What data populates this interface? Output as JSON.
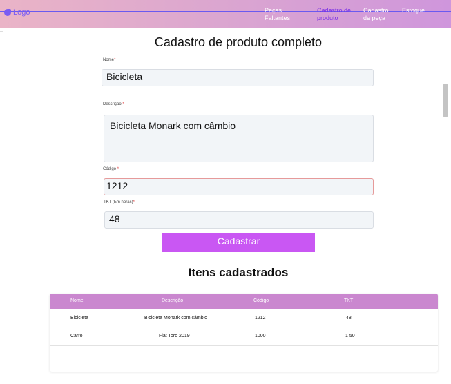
{
  "navbar": {
    "logo": "Logo",
    "links": [
      "Peças Faltantes",
      "Cadastro de produto",
      "Cadastro de peça",
      "Estoque"
    ]
  },
  "form": {
    "title": "Cadastro de produto completo",
    "nome": {
      "label": "Nome",
      "value": "Bicicleta"
    },
    "descricao": {
      "label": "Descrição",
      "value": "Bicicleta Monark com câmbio"
    },
    "codigo": {
      "label": "Código",
      "value": "1212"
    },
    "tkt": {
      "label": "TKT (Em horas)",
      "value": "48"
    },
    "required_mark": "*",
    "submit": "Cadastrar"
  },
  "table": {
    "title": "Itens cadastrados",
    "headers": [
      "Nome",
      "Descrição",
      "Código",
      "TKT"
    ],
    "rows": [
      [
        "Bicicleta",
        "Bicicleta Monark com câmbio",
        "1212",
        "48"
      ],
      [
        "Carro",
        "Fiat Toro 2019",
        "1000",
        "1 50"
      ]
    ]
  },
  "colors": {
    "nav_accent": "#7a5cf3",
    "submit_button": "#c957f3",
    "table_header": "#ca87cf"
  }
}
